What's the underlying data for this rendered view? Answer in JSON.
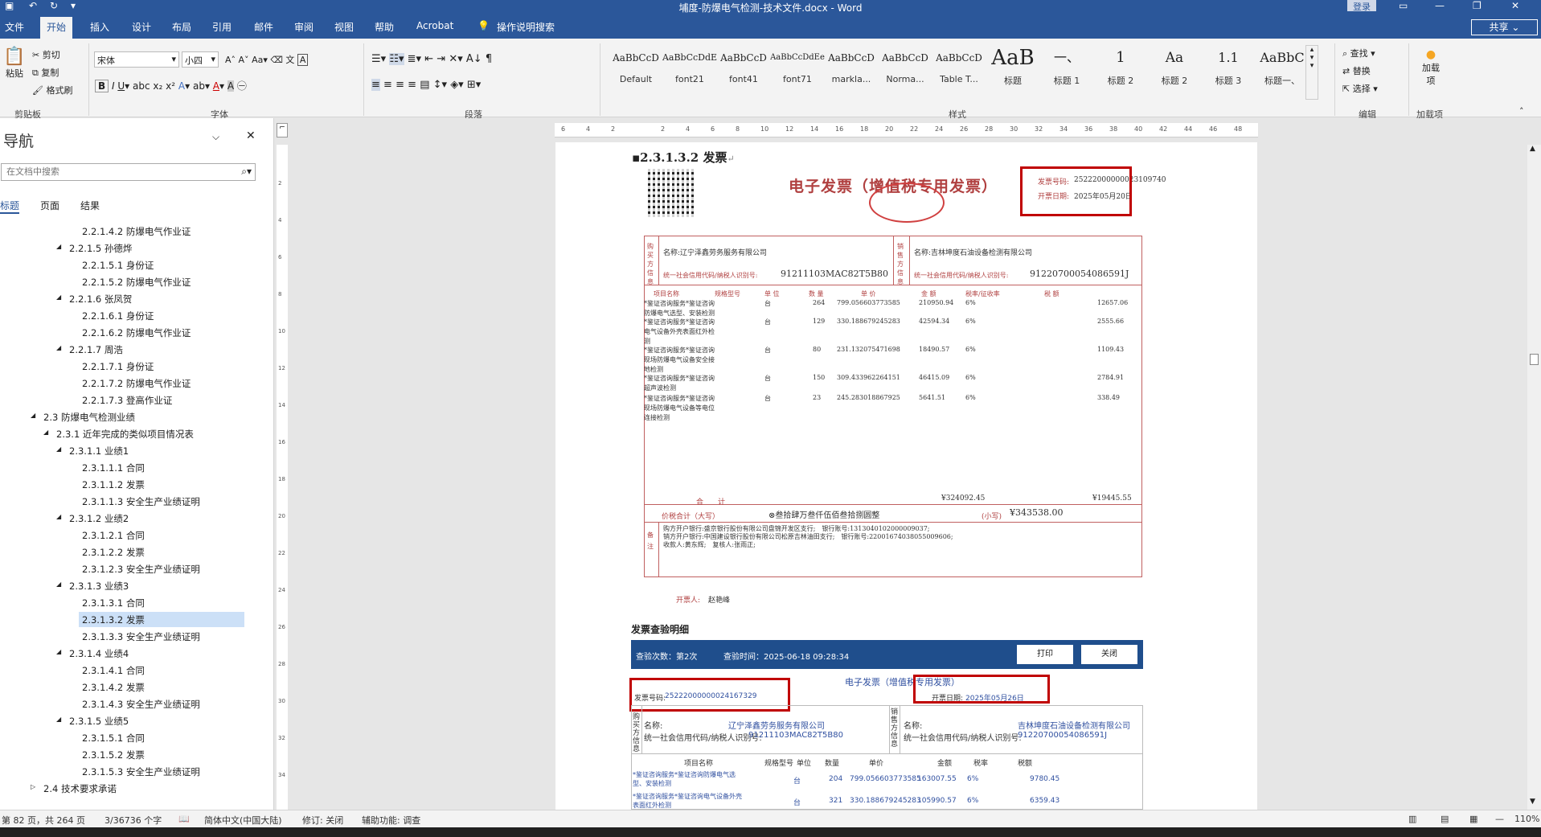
{
  "window": {
    "title": "埔度-防爆电气检测-技术文件.docx - Word",
    "login": "登录",
    "share": "共享"
  },
  "menu": [
    "文件",
    "开始",
    "插入",
    "设计",
    "布局",
    "引用",
    "邮件",
    "审阅",
    "视图",
    "帮助",
    "Acrobat",
    "操作说明搜索"
  ],
  "ribbon": {
    "clipboard": {
      "paste": "粘贴",
      "cut": "剪切",
      "copy": "复制",
      "format_painter": "格式刷",
      "group": "剪贴板"
    },
    "font": {
      "name": "宋体",
      "size": "小四",
      "group": "字体"
    },
    "paragraph": {
      "group": "段落"
    },
    "styles": {
      "group": "样式",
      "items": [
        {
          "preview": "AaBbCcD",
          "name": "Default"
        },
        {
          "preview": "AaBbCcDdE",
          "name": "font21"
        },
        {
          "preview": "AaBbCcD",
          "name": "font41"
        },
        {
          "preview": "AaBbCcDdEe",
          "name": "font71"
        },
        {
          "preview": "AaBbCcD",
          "name": "markla..."
        },
        {
          "preview": "AaBbCcD",
          "name": "Norma..."
        },
        {
          "preview": "AaBbCcD",
          "name": "Table T..."
        },
        {
          "preview": "AaB",
          "name": "标题"
        },
        {
          "preview": "一、",
          "name": "标题 1"
        },
        {
          "preview": "1",
          "name": "标题 2"
        },
        {
          "preview": "Aa",
          "name": "标题 2"
        },
        {
          "preview": "1.1",
          "name": "标题 3"
        },
        {
          "preview": "AaBbC",
          "name": "标题一、"
        }
      ]
    },
    "editing": {
      "find": "查找",
      "replace": "替换",
      "select": "选择",
      "group": "编辑"
    },
    "addins": {
      "label": "加载项",
      "group": "加载项"
    }
  },
  "nav": {
    "title": "导航",
    "search_placeholder": "在文档中搜索",
    "tabs": [
      "标题",
      "页面",
      "结果"
    ],
    "items": [
      {
        "t": "2.2.1.4.2 防爆电气作业证",
        "lvl": 5
      },
      {
        "t": "2.2.1.5 孙德烨",
        "lvl": 4,
        "arrow": true
      },
      {
        "t": "2.2.1.5.1 身份证",
        "lvl": 5
      },
      {
        "t": "2.2.1.5.2 防爆电气作业证",
        "lvl": 5
      },
      {
        "t": "2.2.1.6 张凤贺",
        "lvl": 4,
        "arrow": true
      },
      {
        "t": "2.2.1.6.1 身份证",
        "lvl": 5
      },
      {
        "t": "2.2.1.6.2 防爆电气作业证",
        "lvl": 5
      },
      {
        "t": "2.2.1.7 周浩",
        "lvl": 4,
        "arrow": true
      },
      {
        "t": "2.2.1.7.1 身份证",
        "lvl": 5
      },
      {
        "t": "2.2.1.7.2 防爆电气作业证",
        "lvl": 5
      },
      {
        "t": "2.2.1.7.3 登高作业证",
        "lvl": 5
      },
      {
        "t": "2.3 防爆电气检测业绩",
        "lvl": 2,
        "arrow": true
      },
      {
        "t": "2.3.1 近年完成的类似项目情况表",
        "lvl": 3,
        "arrow": true
      },
      {
        "t": "2.3.1.1 业绩1",
        "lvl": 4,
        "arrow": true
      },
      {
        "t": "2.3.1.1.1 合同",
        "lvl": 5
      },
      {
        "t": "2.3.1.1.2 发票",
        "lvl": 5
      },
      {
        "t": "2.3.1.1.3 安全生产业绩证明",
        "lvl": 5
      },
      {
        "t": "2.3.1.2 业绩2",
        "lvl": 4,
        "arrow": true
      },
      {
        "t": "2.3.1.2.1 合同",
        "lvl": 5
      },
      {
        "t": "2.3.1.2.2 发票",
        "lvl": 5
      },
      {
        "t": "2.3.1.2.3 安全生产业绩证明",
        "lvl": 5
      },
      {
        "t": "2.3.1.3 业绩3",
        "lvl": 4,
        "arrow": true
      },
      {
        "t": "2.3.1.3.1 合同",
        "lvl": 5
      },
      {
        "t": "2.3.1.3.2 发票",
        "lvl": 5,
        "sel": true
      },
      {
        "t": "2.3.1.3.3 安全生产业绩证明",
        "lvl": 5
      },
      {
        "t": "2.3.1.4 业绩4",
        "lvl": 4,
        "arrow": true
      },
      {
        "t": "2.3.1.4.1 合同",
        "lvl": 5
      },
      {
        "t": "2.3.1.4.2 发票",
        "lvl": 5
      },
      {
        "t": "2.3.1.4.3 安全生产业绩证明",
        "lvl": 5
      },
      {
        "t": "2.3.1.5 业绩5",
        "lvl": 4,
        "arrow": true
      },
      {
        "t": "2.3.1.5.1 合同",
        "lvl": 5
      },
      {
        "t": "2.3.1.5.2 发票",
        "lvl": 5
      },
      {
        "t": "2.3.1.5.3 安全生产业绩证明",
        "lvl": 5
      },
      {
        "t": "2.4 技术要求承诺",
        "lvl": 2,
        "arrow": true,
        "collapsed": true
      }
    ]
  },
  "doc": {
    "heading": "2.3.1.3.2 发票",
    "invoice": {
      "title": "电子发票（增值税专用发票）",
      "no_label": "发票号码:",
      "no": "25222000000023109740",
      "date_label": "开票日期:",
      "date": "2025年05月20日",
      "buyer_side": "购买方信息",
      "seller_side": "销售方信息",
      "buyer_name": "名称:辽宁泽鑫劳务服务有限公司",
      "buyer_tax": "统一社会信用代码/纳税人识别号:",
      "buyer_tax_no": "91211103MAC82T5B80",
      "seller_name": "名称:吉林坤度石油设备检测有限公司",
      "seller_tax": "统一社会信用代码/纳税人识别号:",
      "seller_tax_no": "91220700054086591J",
      "headers": [
        "项目名称",
        "规格型号",
        "单 位",
        "数 量",
        "单 价",
        "金 额",
        "税率/征收率",
        "税 额"
      ],
      "rows": [
        {
          "name": [
            "*鉴证咨询服务*鉴证咨询",
            "防爆电气选型、安装检测"
          ],
          "unit": "台",
          "qty": "264",
          "price": "799.056603773585",
          "amount": "210950.94",
          "rate": "6%",
          "tax": "12657.06"
        },
        {
          "name": [
            "*鉴证咨询服务*鉴证咨询",
            "电气设备外壳表面红外检",
            "测"
          ],
          "unit": "台",
          "qty": "129",
          "price": "330.188679245283",
          "amount": "42594.34",
          "rate": "6%",
          "tax": "2555.66"
        },
        {
          "name": [
            "*鉴证咨询服务*鉴证咨询",
            "现场防爆电气设备安全接",
            "地检测"
          ],
          "unit": "台",
          "qty": "80",
          "price": "231.132075471698",
          "amount": "18490.57",
          "rate": "6%",
          "tax": "1109.43"
        },
        {
          "name": [
            "*鉴证咨询服务*鉴证咨询",
            "超声波检测"
          ],
          "unit": "台",
          "qty": "150",
          "price": "309.433962264151",
          "amount": "46415.09",
          "rate": "6%",
          "tax": "2784.91"
        },
        {
          "name": [
            "*鉴证咨询服务*鉴证咨询",
            "现场防爆电气设备等电位",
            "连接检测"
          ],
          "unit": "台",
          "qty": "23",
          "price": "245.283018867925",
          "amount": "5641.51",
          "rate": "6%",
          "tax": "338.49"
        }
      ],
      "total_label": "合　　计",
      "total_amount": "¥324092.45",
      "total_tax": "¥19445.55",
      "sum_label": "价税合计（大写）",
      "sum_words": "叁拾肆万叁仟伍佰叁拾捌圆整",
      "sum_small_label": "(小写)",
      "sum_small": "¥343538.00",
      "remark_label": "备注",
      "remarks": [
        "购方开户银行:盛京银行股份有限公司盘锦开发区支行;　银行账号:1313040102000009037;",
        "销方开户银行:中国建设银行股份有限公司松原吉林油田支行;　银行账号:22001674038055009606;",
        "收款人:黄东辉;　复核人:张雨正;"
      ],
      "drawer_label": "开票人:",
      "drawer": "赵艳峰"
    },
    "verify": {
      "title": "发票查验明细",
      "count": "查验次数：第2次",
      "time": "查验时间：2025-06-18 09:28:34",
      "print": "打印",
      "close": "关闭",
      "inv_title": "电子发票（增值税专用发票）",
      "no_label": "发票号码:",
      "no": "25222000000024167329",
      "date_label": "开票日期:",
      "date": "2025年05月26日",
      "buyer_side": "购买方信息",
      "seller_side": "销售方信息",
      "name_label": "名称:",
      "buyer_name": "辽宁泽鑫劳务服务有限公司",
      "tax_label": "统一社会信用代码/纳税人识别号:",
      "buyer_tax_no": "91211103MAC82T5B80",
      "seller_name": "吉林坤度石油设备检测有限公司",
      "seller_tax_no": "91220700054086591J",
      "headers": [
        "项目名称",
        "规格型号",
        "单位",
        "数量",
        "单价",
        "金额",
        "税率",
        "税额"
      ],
      "rows": [
        {
          "name": "*鉴证咨询服务*鉴证咨询防爆电气选型、安装检测",
          "unit": "台",
          "qty": "204",
          "price": "799.056603773585",
          "amount": "163007.55",
          "rate": "6%",
          "tax": "9780.45"
        },
        {
          "name": "*鉴证咨询服务*鉴证咨询电气设备外壳表面红外检测",
          "unit": "台",
          "qty": "321",
          "price": "330.188679245283",
          "amount": "105990.57",
          "rate": "6%",
          "tax": "6359.43"
        }
      ]
    }
  },
  "status": {
    "page": "第 82 页，共 264 页",
    "words": "3/36736 个字",
    "lang": "简体中文(中国大陆)",
    "track": "修订: 关闭",
    "access": "辅助功能: 调查",
    "zoom": "110%"
  },
  "colors": {
    "accent": "#2b579a",
    "invoice_red": "#b04040",
    "highlight_box": "#c00000",
    "verify_bar": "#1f4e8c"
  }
}
